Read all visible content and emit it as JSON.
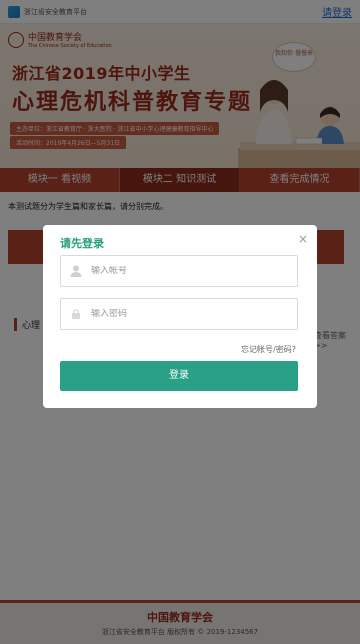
{
  "topbar": {
    "site_title": "浙江省安全教育平台",
    "login_link": "请登录"
  },
  "banner": {
    "org_cn": "中国教育学会",
    "org_en": "The Chinese Society of Education",
    "line1": "浙江省2019年中小学生",
    "line2": "心理危机科普教育专题",
    "sub_a": "主办单位：浙江省教育厅 · 浙大医院 · 浙江省中小学心理健康教育指导中心",
    "sub_b": "活动时间：2019年4月26日—5月31日",
    "bubble": "我和你 慢慢来"
  },
  "tabs": [
    {
      "label": "模块一 看视频"
    },
    {
      "label": "模块二 知识测试"
    },
    {
      "label": "查看完成情况"
    }
  ],
  "intro_text": "本测试题分为学生篇和家长篇，请分别完成。",
  "section_title": "心理",
  "see_link": "查看答案 >>",
  "footer": {
    "logo": "中国教育学会",
    "text": "浙江省安全教育平台 版权所有 © 2019-1234567"
  },
  "modal": {
    "title": "请先登录",
    "close": "×",
    "username_placeholder": "输入帐号",
    "password_placeholder": "输入密码",
    "forgot": "忘记帐号/密码?",
    "login_button": "登录"
  },
  "colors": {
    "brand_red": "#b4432f",
    "accent_green": "#2aa186",
    "title_green": "#28a07c"
  }
}
